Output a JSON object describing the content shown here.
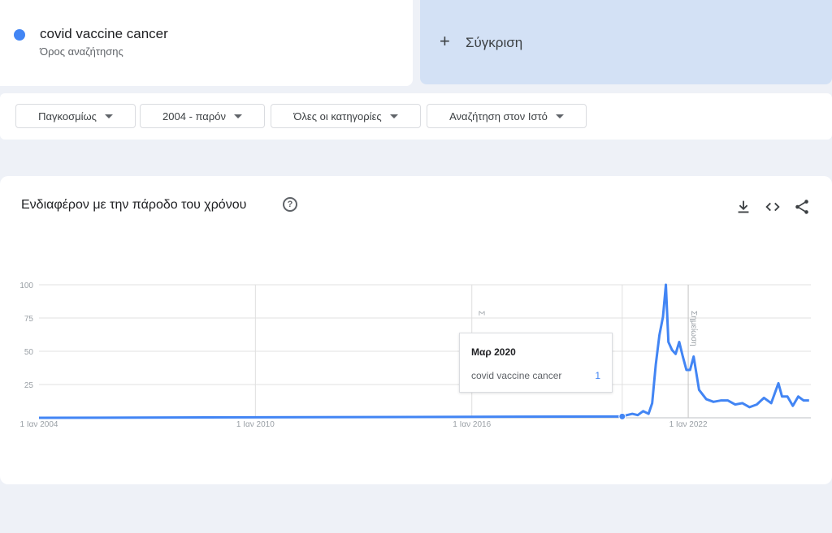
{
  "term": {
    "name": "covid vaccine cancer",
    "subtitle": "Όρος αναζήτησης",
    "color": "#4285f4"
  },
  "compare": {
    "label": "Σύγκριση"
  },
  "filters": [
    {
      "label": "Παγκοσμίως"
    },
    {
      "label": "2004 - παρόν"
    },
    {
      "label": "Όλες οι κατηγορίες"
    },
    {
      "label": "Αναζήτηση στον Ιστό"
    }
  ],
  "chart_section": {
    "title": "Ενδιαφέρον με την πάροδο του χρόνου",
    "help_icon": "help-icon",
    "actions": [
      "download-icon",
      "embed-icon",
      "share-icon"
    ]
  },
  "tooltip": {
    "date": "Μαρ 2020",
    "term": "covid vaccine cancer",
    "value": "1"
  },
  "chart_data": {
    "type": "line",
    "ylim": [
      0,
      100
    ],
    "yticks": [
      25,
      50,
      75,
      100
    ],
    "xticks": [
      "1 Ιαν 2004",
      "1 Ιαν 2010",
      "1 Ιαν 2016",
      "1 Ιαν 2022"
    ],
    "xrange": [
      2004.0,
      2025.4
    ],
    "annotation": "Σημείωση",
    "annotation_partial": "Σ",
    "series": [
      {
        "name": "covid vaccine cancer",
        "color": "#4285f4",
        "x": [
          2004.0,
          2020.17,
          2020.3,
          2020.45,
          2020.6,
          2020.75,
          2020.9,
          2021.0,
          2021.1,
          2021.2,
          2021.3,
          2021.38,
          2021.45,
          2021.55,
          2021.65,
          2021.75,
          2021.85,
          2021.95,
          2022.05,
          2022.15,
          2022.3,
          2022.5,
          2022.7,
          2022.9,
          2023.1,
          2023.3,
          2023.5,
          2023.7,
          2023.9,
          2024.1,
          2024.3,
          2024.5,
          2024.6,
          2024.75,
          2024.9,
          2025.05,
          2025.2,
          2025.35
        ],
        "values": [
          0,
          1,
          2,
          3,
          2,
          5,
          3,
          11,
          40,
          62,
          76,
          100,
          57,
          51,
          48,
          57,
          46,
          36,
          36,
          46,
          21,
          14,
          12,
          13,
          13,
          10,
          11,
          8,
          10,
          15,
          11,
          26,
          16,
          16,
          9,
          16,
          13,
          13
        ]
      }
    ]
  }
}
